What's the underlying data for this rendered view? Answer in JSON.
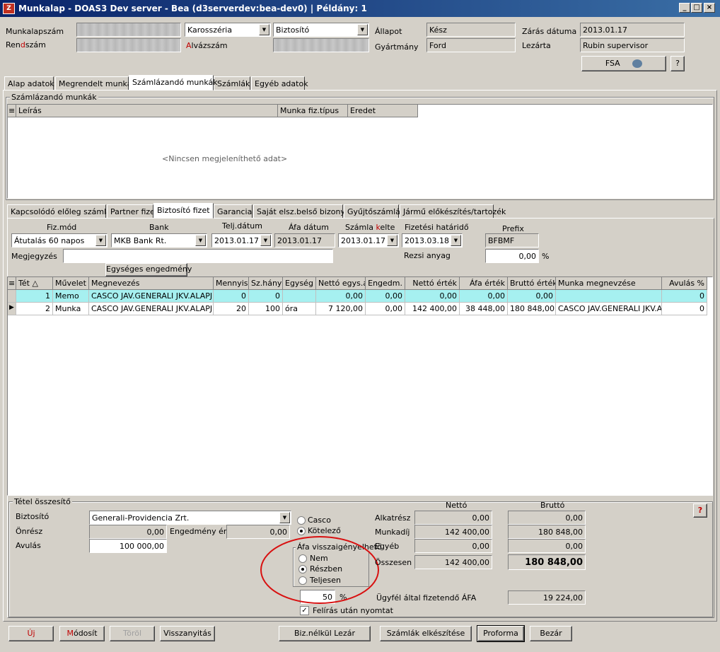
{
  "window": {
    "title": "Munkalap - DOAS3 Dev server - Bea (d3serverdev:bea-dev0) | Példány: 1",
    "icon": "app-icon",
    "min": "_",
    "max": "□",
    "close": "×"
  },
  "header": {
    "munkalapszam_label": "Munkalapszám",
    "rendszam_label": "Rendszám",
    "rendszam_label_hi": "d",
    "karosszeria": "Karosszéria",
    "biztosito": "Biztosító",
    "alvazszam_label": "Alvázszám",
    "allapot_label": "Állapot",
    "allapot": "Kész",
    "gyartmany_label": "Gyártmány",
    "gyartmany": "Ford",
    "zaras_label": "Zárás dátuma",
    "zaras": "2013.01.17",
    "lezarta_label": "Lezárta",
    "lezarta": "Rubin supervisor",
    "fsa": "FSA",
    "help": "?"
  },
  "tabs": [
    "Alap adatok",
    "Megrendelt munkák",
    "Számlázandó munkák",
    "Számlák",
    "Egyéb adatok"
  ],
  "szamlazando": {
    "title": "Számlázandó munkák",
    "cols": [
      "Leírás",
      "Munka fiz.típus",
      "Eredet"
    ],
    "empty": "<Nincsen megjeleníthető adat>"
  },
  "subtabs": [
    "Kapcsolódó előleg számlák",
    "Partner fizet",
    "Biztosító fizet",
    "Garancia",
    "Saját elsz.belső bizonylat",
    "Gyűjtőszámlára",
    "Jármű előkészítés/tartozék"
  ],
  "fizform": {
    "fizmod_label": "Fiz.mód",
    "fizmod": "Átutalás 60 napos",
    "bank_label": "Bank",
    "bank": "MKB Bank Rt.",
    "telj_label": "Telj.dátum",
    "telj": "2013.01.17",
    "afa_label": "Áfa dátum",
    "afa": "2013.01.17",
    "kelte_label_a": "Számla ",
    "kelte_label_b": "k",
    "kelte_label_c": "elte",
    "kelte": "2013.01.17",
    "hatarido_label": "Fizetési határidő",
    "hatarido": "2013.03.18",
    "prefix_label": "Prefix",
    "prefix": "BFBMF",
    "rezsi_label": "Rezsi anyag",
    "rezsi": "0,00",
    "pct": "%",
    "megj_label": "Megjegyzés",
    "megj": "",
    "egyseges": "Egységes engedmény"
  },
  "items": {
    "cols": [
      "Tét",
      "Művelet",
      "Megnevezés",
      "Mennyiség",
      "Sz.hányad",
      "Egység",
      "Nettó egys.ár",
      "Engedm.",
      "Nettó érték",
      "Áfa érték",
      "Bruttó érték",
      "Munka megnevzése",
      "Avulás %"
    ],
    "rows": [
      [
        "1",
        "Memo",
        "CASCO JAV.GENERALI JKV.ALAPJ",
        "0",
        "0",
        "",
        "0,00",
        "0,00",
        "0,00",
        "0,00",
        "0,00",
        "",
        "0"
      ],
      [
        "2",
        "Munka",
        "CASCO JAV.GENERALI JKV.ALAPJ",
        "20",
        "100",
        "óra",
        "7 120,00",
        "0,00",
        "142 400,00",
        "38 448,00",
        "180 848,00",
        "CASCO JAV.GENERALI JKV.A",
        "0"
      ]
    ]
  },
  "summary": {
    "title": "Tétel összesítő",
    "biztosito_label": "Biztosító",
    "biztosito": "Generali-Providencia Zrt.",
    "onresz_label": "Önrész",
    "onresz": "0,00",
    "engedmeny_label": "Engedmény ért.",
    "engedmeny": "0,00",
    "avulas_label": "Avulás",
    "avulas": "100 000,00",
    "casco": "Casco",
    "kotelezo": "Kötelező",
    "afa_title": "Áfa visszaigényelhető",
    "nem": "Nem",
    "reszben": "Részben",
    "teljesen": "Teljesen",
    "pct_val": "50",
    "pct": "%",
    "felirat": "Felírás után nyomtat",
    "netto_h": "Nettó",
    "brutto_h": "Bruttó",
    "rows": [
      {
        "label": "Alkatrész",
        "netto": "0,00",
        "brutto": "0,00"
      },
      {
        "label": "Munkadíj",
        "netto": "142 400,00",
        "brutto": "180 848,00"
      },
      {
        "label": "Egyéb",
        "netto": "0,00",
        "brutto": "0,00"
      },
      {
        "label": "Összesen",
        "netto": "142 400,00",
        "brutto": "180 848,00"
      }
    ],
    "ugyfel_label": "Ügyfél által fizetendő ÁFA",
    "ugyfel": "19 224,00",
    "help": "?"
  },
  "footer": {
    "uj": "Új",
    "modosit": "Módosít",
    "torol": "Töröl",
    "visszanyitas": "Visszanyitás",
    "biz": "Biz.nélkül Lezár",
    "szamlak": "Számlák elkészítése",
    "proforma": "Proforma",
    "bezar": "Bezár"
  },
  "colors": {
    "title_bar": "#0a246a",
    "selected_row": "#a6f0f0",
    "annotation": "#d81010",
    "red_text": "#c00000"
  }
}
